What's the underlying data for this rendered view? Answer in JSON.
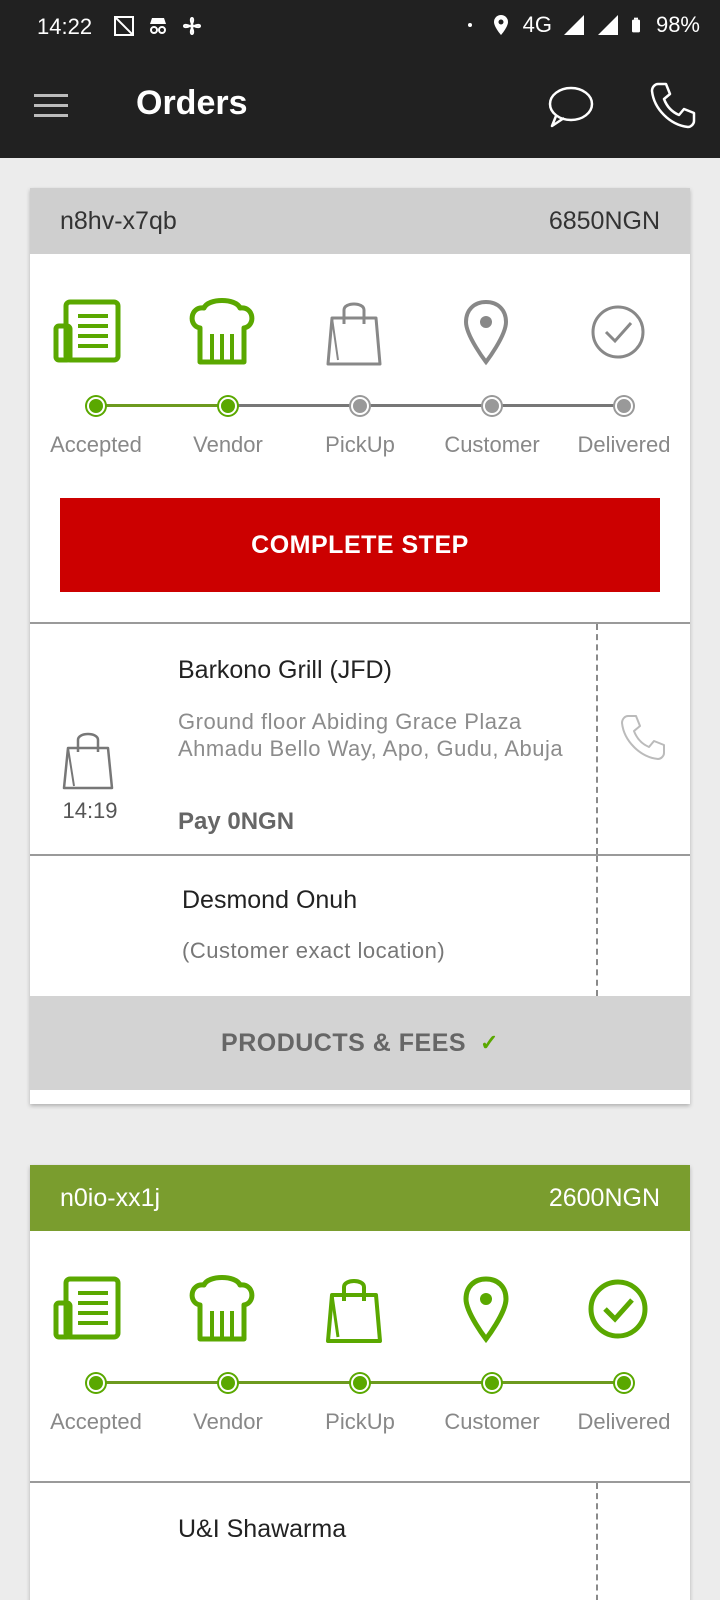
{
  "status_bar": {
    "time": "14:22",
    "network": "4G",
    "battery": "98%",
    "left_icons": [
      "screenshot-icon",
      "incognito-icon",
      "fan-icon"
    ],
    "right_icons": [
      "dot-icon",
      "location-icon",
      "signal-icon",
      "battery-icon"
    ]
  },
  "app_bar": {
    "title": "Orders",
    "icons": [
      "menu-icon",
      "chat-icon",
      "phone-icon"
    ]
  },
  "colors": {
    "green": "#5aa800",
    "header_green": "#7a9d2e",
    "red_button": "#cc0000",
    "gray_header": "#cfcfcf",
    "dark_bar": "#212121"
  },
  "orders": [
    {
      "id": "n8hv-x7qb",
      "amount": "6850NGN",
      "steps_completed": 2,
      "steps": [
        "Accepted",
        "Vendor",
        "PickUp",
        "Customer",
        "Delivered"
      ],
      "action_button": "COMPLETE STEP",
      "vendor": {
        "name": "Barkono Grill  (JFD)",
        "address": "Ground floor Abiding Grace Plaza Ahmadu Bello Way, Apo, Gudu, Abuja",
        "time": "14:19",
        "pay": "Pay 0NGN"
      },
      "customer": {
        "name": "Desmond Onuh",
        "location": "(Customer exact location)"
      },
      "products_label": "PRODUCTS & FEES",
      "products_check": "✓"
    },
    {
      "id": "n0io-xx1j",
      "amount": "2600NGN",
      "steps_completed": 5,
      "steps": [
        "Accepted",
        "Vendor",
        "PickUp",
        "Customer",
        "Delivered"
      ],
      "vendor": {
        "name": "U&I Shawarma"
      }
    }
  ]
}
